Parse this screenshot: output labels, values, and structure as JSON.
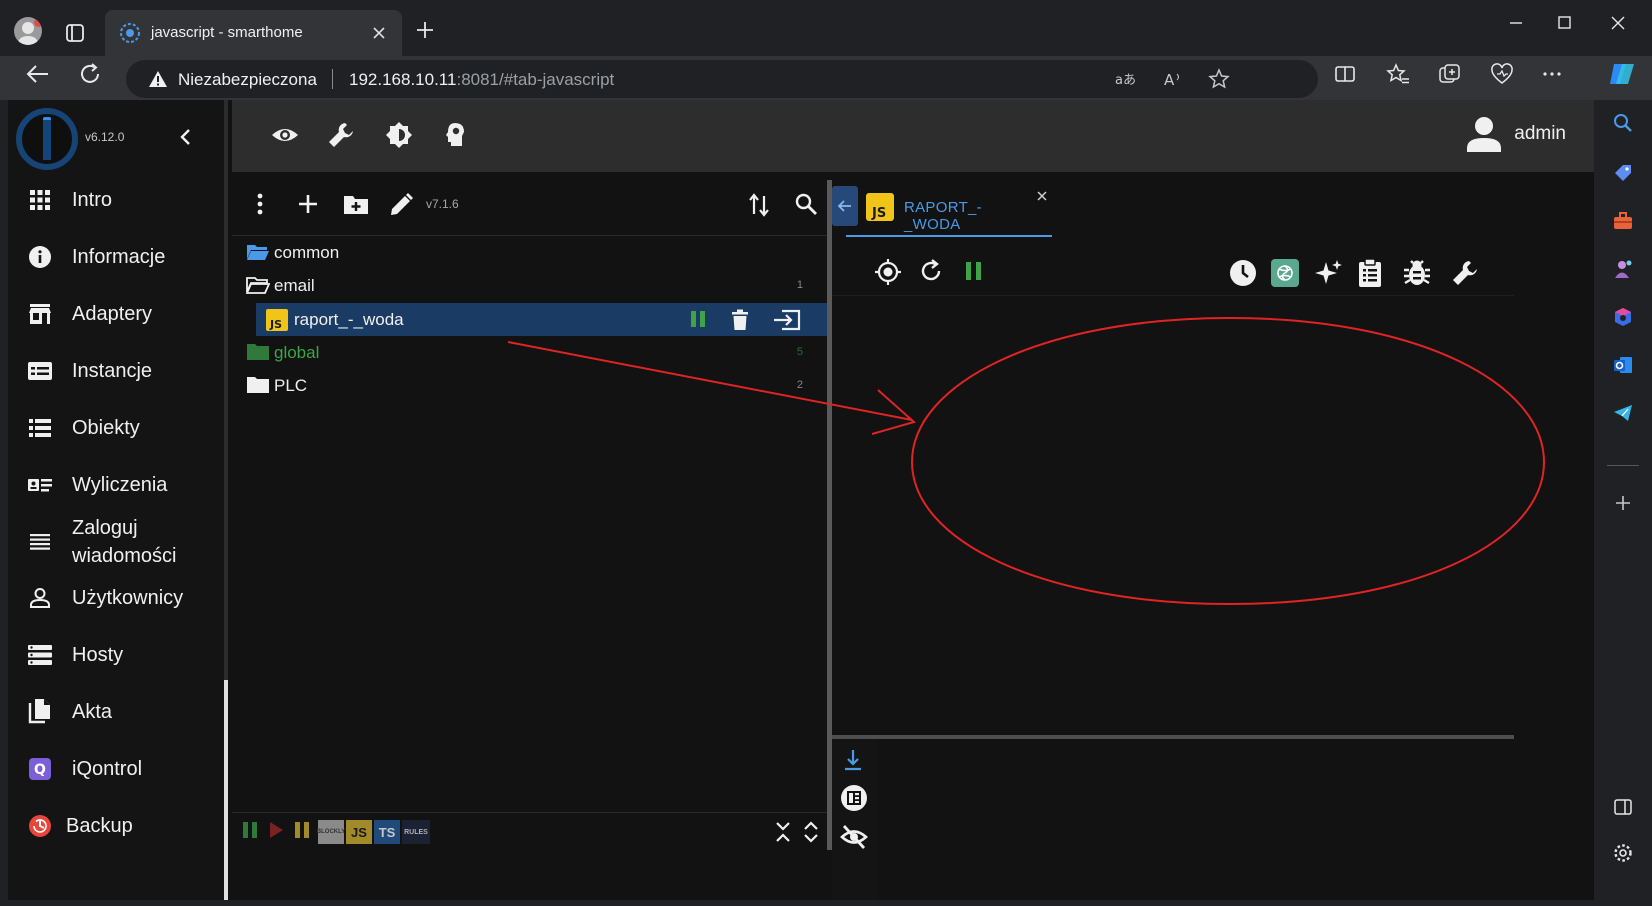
{
  "browser": {
    "tab_title": "javascript - smarthome",
    "not_secure_label": "Niezabezpieczona",
    "url_host": "192.168.10.11",
    "url_rest": ":8081/#tab-javascript",
    "icons": [
      "profile-icon",
      "tab-actions-icon",
      "close-tab-icon",
      "new-tab-icon",
      "minimize-icon",
      "maximize-icon",
      "close-window-icon",
      "back-icon",
      "reload-icon",
      "warning-icon",
      "translate-icon",
      "read-aloud-icon",
      "favorite-star-icon",
      "split-screen-icon",
      "favorites-icon",
      "collections-icon",
      "browser-essentials-icon",
      "more-icon",
      "copilot-icon"
    ]
  },
  "edge_sidebar": {
    "icons": [
      "search-icon",
      "shopping-icon",
      "tools-icon",
      "games-icon",
      "office-icon",
      "outlook-icon",
      "telegram-icon",
      "add-icon",
      "sidebar-toggle-icon",
      "settings-icon"
    ]
  },
  "app": {
    "version": "v6.12.0",
    "user": "admin",
    "nav": [
      {
        "label": "Intro",
        "icon": "grid-icon"
      },
      {
        "label": "Informacje",
        "icon": "info-icon"
      },
      {
        "label": "Adaptery",
        "icon": "store-icon"
      },
      {
        "label": "Instancje",
        "icon": "instances-icon"
      },
      {
        "label": "Obiekty",
        "icon": "list-icon"
      },
      {
        "label": "Wyliczenia",
        "icon": "enums-icon"
      },
      {
        "label": "Zaloguj",
        "label2": "wiadomości",
        "icon": "log-icon"
      },
      {
        "label": "Użytkownicy",
        "icon": "person-icon"
      },
      {
        "label": "Hosty",
        "icon": "hosts-icon"
      },
      {
        "label": "Akta",
        "icon": "files-icon"
      },
      {
        "label": "iQontrol",
        "icon": "iqontrol-icon"
      },
      {
        "label": "Backup",
        "icon": "backup-icon"
      }
    ],
    "appbar_icons": [
      "eye-icon",
      "wrench-icon",
      "brightness-icon",
      "expert-mode-icon"
    ]
  },
  "tree": {
    "version": "v7.1.6",
    "items": [
      {
        "name": "common",
        "count": "",
        "color": "#f0f0f0",
        "folder_color": "#4a9ae8"
      },
      {
        "name": "email",
        "count": "1",
        "color": "#f0f0f0",
        "folder_color": "#f0f0f0"
      },
      {
        "name": "raport_-_woda",
        "count": "",
        "color": "#ffffff",
        "selected": true
      },
      {
        "name": "global",
        "count": "5",
        "color": "#3fa447",
        "folder_color": "#2f7a3a"
      },
      {
        "name": "PLC",
        "count": "2",
        "color": "#f0f0f0",
        "folder_color": "#f0f0f0"
      }
    ],
    "footer_badges": [
      "BLOCKLY",
      "JS",
      "TS",
      "RULES"
    ]
  },
  "editor": {
    "tab_name": "RAPORT_-_WODA",
    "toolbar_icons": [
      "target-icon",
      "restart-icon",
      "pause-icon",
      "cron-clock-icon",
      "chatgpt-icon",
      "ai-sparkle-icon",
      "clipboard-icon",
      "debug-bug-icon",
      "settings-wrench-icon"
    ],
    "log_icons": [
      "scroll-down-icon",
      "log-table-icon",
      "hide-eye-icon"
    ]
  },
  "colors": {
    "accent": "#4a9ae8",
    "selected_row": "#1a3b63",
    "js_yellow": "#f0c419",
    "annotation_red": "#e02424",
    "green": "#3fa447"
  }
}
